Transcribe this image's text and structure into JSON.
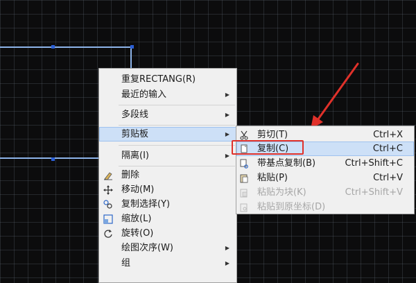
{
  "context_menu": {
    "items": [
      {
        "label": "重复RECTANG(R)",
        "icon": "",
        "submenu": false
      },
      {
        "label": "最近的输入",
        "icon": "",
        "submenu": true
      },
      {
        "label": "多段线",
        "icon": "",
        "submenu": true
      },
      {
        "label": "剪贴板",
        "icon": "",
        "submenu": true
      },
      {
        "label": "隔离(I)",
        "icon": "",
        "submenu": true
      },
      {
        "label": "删除",
        "icon": "eraser-icon",
        "submenu": false
      },
      {
        "label": "移动(M)",
        "icon": "move-icon",
        "submenu": false
      },
      {
        "label": "复制选择(Y)",
        "icon": "copy-selection-icon",
        "submenu": false
      },
      {
        "label": "缩放(L)",
        "icon": "scale-icon",
        "submenu": false
      },
      {
        "label": "旋转(O)",
        "icon": "rotate-icon",
        "submenu": false
      },
      {
        "label": "绘图次序(W)",
        "icon": "",
        "submenu": true
      },
      {
        "label": "组",
        "icon": "",
        "submenu": true
      }
    ],
    "highlighted": "剪贴板",
    "submenu_glyph": "▶"
  },
  "clipboard_submenu": {
    "items": [
      {
        "label": "剪切(T)",
        "shortcut": "Ctrl+X",
        "icon": "scissors-icon",
        "enabled": true
      },
      {
        "label": "复制(C)",
        "shortcut": "Ctrl+C",
        "icon": "copy-icon",
        "enabled": true
      },
      {
        "label": "带基点复制(B)",
        "shortcut": "Ctrl+Shift+C",
        "icon": "copy-base-point-icon",
        "enabled": true
      },
      {
        "label": "粘贴(P)",
        "shortcut": "Ctrl+V",
        "icon": "paste-icon",
        "enabled": true
      },
      {
        "label": "粘贴为块(K)",
        "shortcut": "Ctrl+Shift+V",
        "icon": "paste-block-icon",
        "enabled": false
      },
      {
        "label": "粘贴到原坐标(D)",
        "shortcut": "",
        "icon": "paste-original-coords-icon",
        "enabled": false
      }
    ],
    "highlighted": "复制(C)"
  },
  "colors": {
    "canvas_bg": "#0c0c0d",
    "highlight": "#cde0f7",
    "annotation_red": "#e0312a",
    "rectangle_stroke": "#8db4ea"
  }
}
